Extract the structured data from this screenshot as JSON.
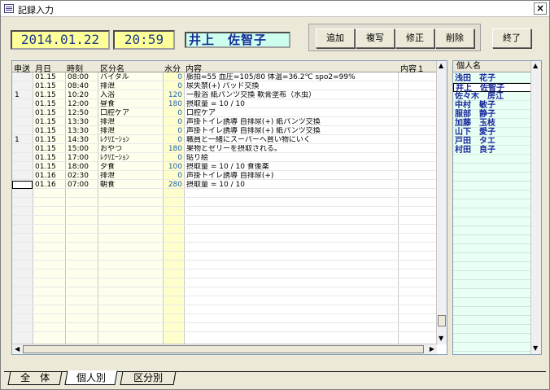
{
  "window": {
    "title": "記録入力",
    "close_label": "×"
  },
  "header": {
    "date": "2014.01.22",
    "time": "20:59",
    "resident_name": "井上　佐智子"
  },
  "toolbar": {
    "add": "追加",
    "copy": "複写",
    "edit": "修正",
    "delete": "削除",
    "exit": "終了"
  },
  "grid": {
    "columns": [
      "申送",
      "月日",
      "時刻",
      "区分名",
      "水分",
      "内容",
      "内容１"
    ],
    "rows": [
      {
        "flag": "",
        "date": "01.15",
        "time": "08:00",
        "category": "バイタル",
        "water": "0",
        "content": "脈拍=55 血圧=105/80  体温=36.2℃  spo2=99%"
      },
      {
        "flag": "",
        "date": "01.15",
        "time": "08:40",
        "category": "排泄",
        "water": "0",
        "content": "尿失禁(+)  パッド交換"
      },
      {
        "flag": "1",
        "date": "01.15",
        "time": "10:20",
        "category": "入浴",
        "water": "120",
        "content": "一般浴  紙パンツ交換  軟膏塗布（水虫）"
      },
      {
        "flag": "",
        "date": "01.15",
        "time": "12:00",
        "category": "昼食",
        "water": "180",
        "content": "摂取量 = 10 / 10"
      },
      {
        "flag": "",
        "date": "01.15",
        "time": "12:50",
        "category": "口腔ケア",
        "water": "0",
        "content": "口腔ケア"
      },
      {
        "flag": "",
        "date": "01.15",
        "time": "13:30",
        "category": "排泄",
        "water": "0",
        "content": "声掛トイレ誘導  自排尿(+)  紙パンツ交換"
      },
      {
        "flag": "",
        "date": "01.15",
        "time": "13:30",
        "category": "排泄",
        "water": "0",
        "content": "声掛トイレ誘導  自排尿(+)  紙パンツ交換"
      },
      {
        "flag": "1",
        "date": "01.15",
        "time": "14:30",
        "category": "ﾚｸﾘｴｰｼｮﾝ",
        "water": "0",
        "content": "職員と一緒にスーパーへ買い物にいく"
      },
      {
        "flag": "",
        "date": "01.15",
        "time": "15:00",
        "category": "おやつ",
        "water": "180",
        "content": "果物とゼリーを摂取される。"
      },
      {
        "flag": "",
        "date": "01.15",
        "time": "17:00",
        "category": "ﾚｸﾘｴｰｼｮﾝ",
        "water": "0",
        "content": "貼り絵"
      },
      {
        "flag": "",
        "date": "01.15",
        "time": "18:00",
        "category": "夕食",
        "water": "100",
        "content": "摂取量 = 10 / 10  食後薬"
      },
      {
        "flag": "",
        "date": "01.16",
        "time": "02:30",
        "category": "排泄",
        "water": "0",
        "content": "声掛トイレ誘導  自排尿(+)"
      },
      {
        "flag": "",
        "date": "01.16",
        "time": "07:00",
        "category": "朝食",
        "water": "280",
        "content": "摂取量 = 10 / 10"
      }
    ]
  },
  "people": {
    "header": "個人名",
    "items": [
      "浅田　花子",
      "井上　佐智子",
      "佐々木　房江",
      "中村　敏子",
      "服部　静子",
      "加藤　玉枝",
      "山下　愛子",
      "戸田　タエ",
      "村田　良子"
    ],
    "selected": "井上　佐智子"
  },
  "tabs": [
    "全　体",
    "個人別",
    "区分別"
  ],
  "active_tab": "個人別",
  "colors": {
    "date_bg": "#ffff99",
    "name_bg": "#ccffee",
    "water_col_bg": "#ffffcc",
    "list_bg": "#e8fff4",
    "text_blue": "#1a2a9a"
  }
}
